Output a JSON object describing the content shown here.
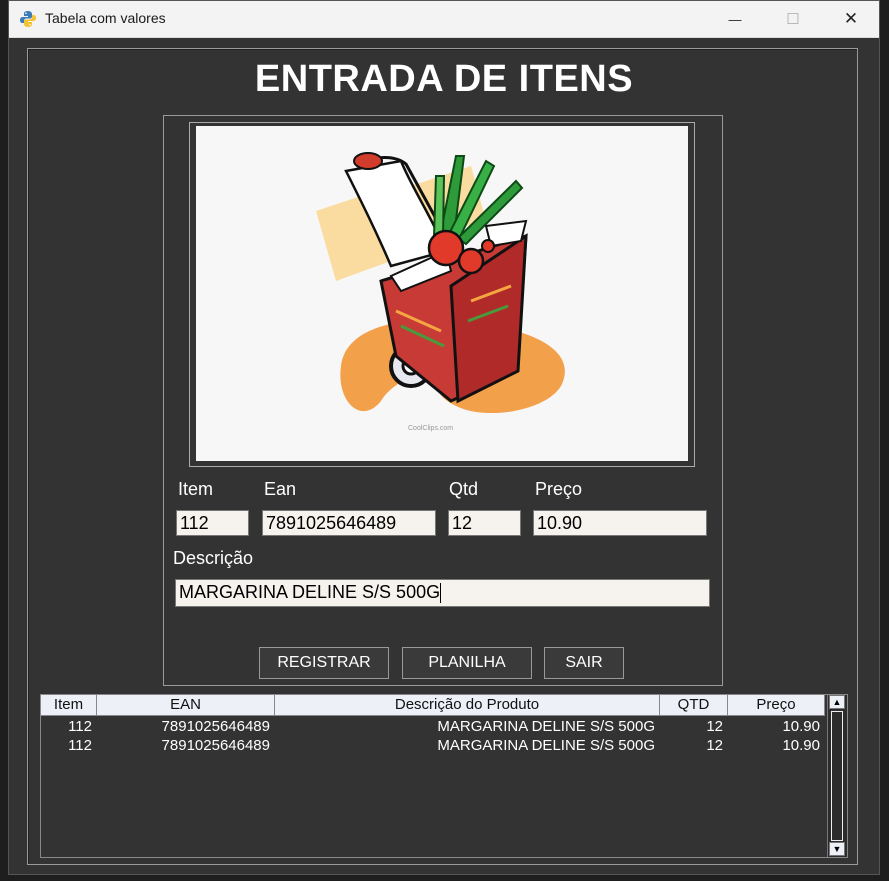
{
  "window": {
    "title": "Tabela com valores",
    "controls": {
      "minimize": "—",
      "maximize": "☐",
      "close": "✕"
    }
  },
  "heading": "ENTRADA DE ITENS",
  "image": {
    "watermark": "CoolClips.com"
  },
  "form": {
    "item_label": "Item",
    "item_value": "112",
    "ean_label": "Ean",
    "ean_value": "7891025646489",
    "qtd_label": "Qtd",
    "qtd_value": "12",
    "preco_label": "Preço",
    "preco_value": "10.90",
    "descricao_label": "Descrição",
    "descricao_value": "MARGARINA DELINE S/S 500G"
  },
  "buttons": {
    "registrar": "REGISTRAR",
    "planilha": "PLANILHA",
    "sair": "SAIR"
  },
  "table": {
    "columns": [
      "Item",
      "EAN",
      "Descrição do Produto",
      "QTD",
      "Preço"
    ],
    "rows": [
      [
        "112",
        "7891025646489",
        "MARGARINA DELINE S/S 500G",
        "12",
        "10.90"
      ],
      [
        "112",
        "7891025646489",
        "MARGARINA DELINE S/S 500G",
        "12",
        "10.90"
      ]
    ]
  },
  "colors": {
    "window_bg": "#333333",
    "input_bg": "#f6f2ee",
    "header_bg": "#eef0f8"
  }
}
